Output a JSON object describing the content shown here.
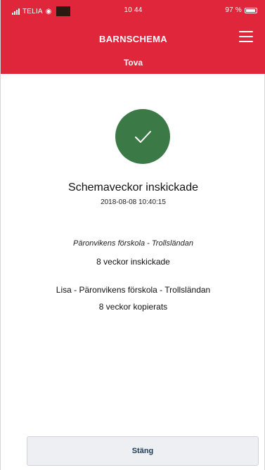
{
  "status_bar": {
    "carrier": "TELIA",
    "time": "10 44",
    "battery": "97 %"
  },
  "header": {
    "title": "BARNSCHEMA",
    "subtitle": "Tova"
  },
  "confirmation": {
    "title": "Schemaveckor inskickade",
    "timestamp": "2018-08-08 10:40:15"
  },
  "submitted": {
    "school": "Päronvikens förskola - Trollsländan",
    "count_text": "8 veckor inskickade"
  },
  "copied": {
    "school": "Lisa - Päronvikens förskola - Trollsländan",
    "count_text": "8 veckor kopierats"
  },
  "footer": {
    "close_label": "Stäng"
  },
  "colors": {
    "header": "#e0263a",
    "success": "#3b7a47"
  },
  "icons": {
    "menu": "hamburger-menu-icon",
    "success": "checkmark-icon"
  }
}
